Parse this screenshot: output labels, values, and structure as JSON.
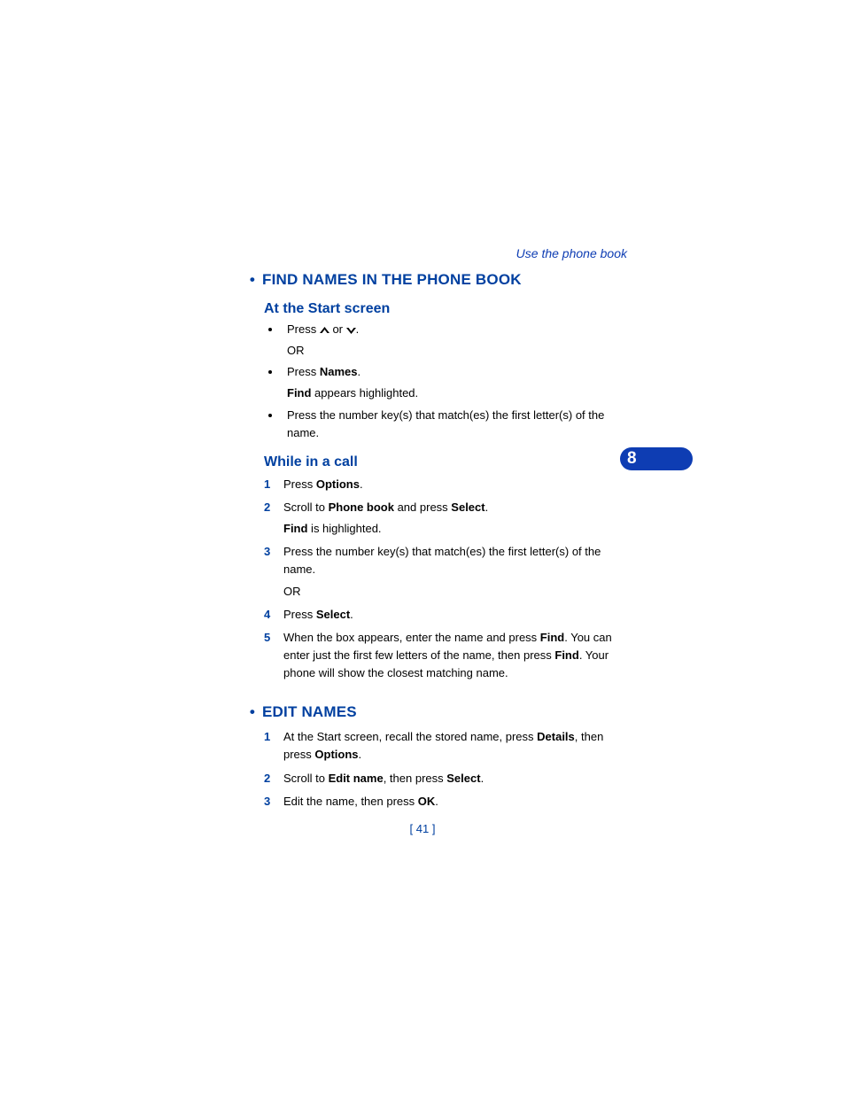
{
  "runningHead": "Use the phone book",
  "chapterTab": "8",
  "pageNumber": "[ 41 ]",
  "heading1": "FIND NAMES IN THE PHONE BOOK",
  "h2a": "At the Start screen",
  "start": {
    "li1_a": "Press ",
    "li1_b": " or ",
    "li1_c": ".",
    "li1_sub": "OR",
    "li2_a": "Press ",
    "li2_bold": "Names",
    "li2_c": ".",
    "li2_sub_bold": "Find",
    "li2_sub_rest": " appears highlighted.",
    "li3": "Press the number key(s) that match(es) the first letter(s) of the name."
  },
  "h2b": "While in a call",
  "call": {
    "s1_a": "Press ",
    "s1_bold": "Options",
    "s1_c": ".",
    "s2_a": "Scroll to ",
    "s2_bold1": "Phone book",
    "s2_mid": " and press ",
    "s2_bold2": "Select",
    "s2_c": ".",
    "s2_sub_bold": "Find",
    "s2_sub_rest": " is highlighted.",
    "s3": "Press the number key(s) that match(es) the first letter(s) of the name.",
    "s3_sub": "OR",
    "s4_a": "Press ",
    "s4_bold": "Select",
    "s4_c": ".",
    "s5_a": "When the box appears, enter the name and press ",
    "s5_bold1": "Find",
    "s5_mid": ". You can enter just the first few letters of the name, then press ",
    "s5_bold2": "Find",
    "s5_rest": ". Your phone will show the closest matching name."
  },
  "heading2": "EDIT NAMES",
  "edit": {
    "s1_a": "At the Start screen, recall the stored name, press ",
    "s1_bold1": "Details",
    "s1_mid": ", then press ",
    "s1_bold2": "Options",
    "s1_c": ".",
    "s2_a": "Scroll to ",
    "s2_bold1": "Edit name",
    "s2_mid": ", then press ",
    "s2_bold2": "Select",
    "s2_c": ".",
    "s3_a": "Edit the name, then press ",
    "s3_bold": "OK",
    "s3_c": "."
  }
}
